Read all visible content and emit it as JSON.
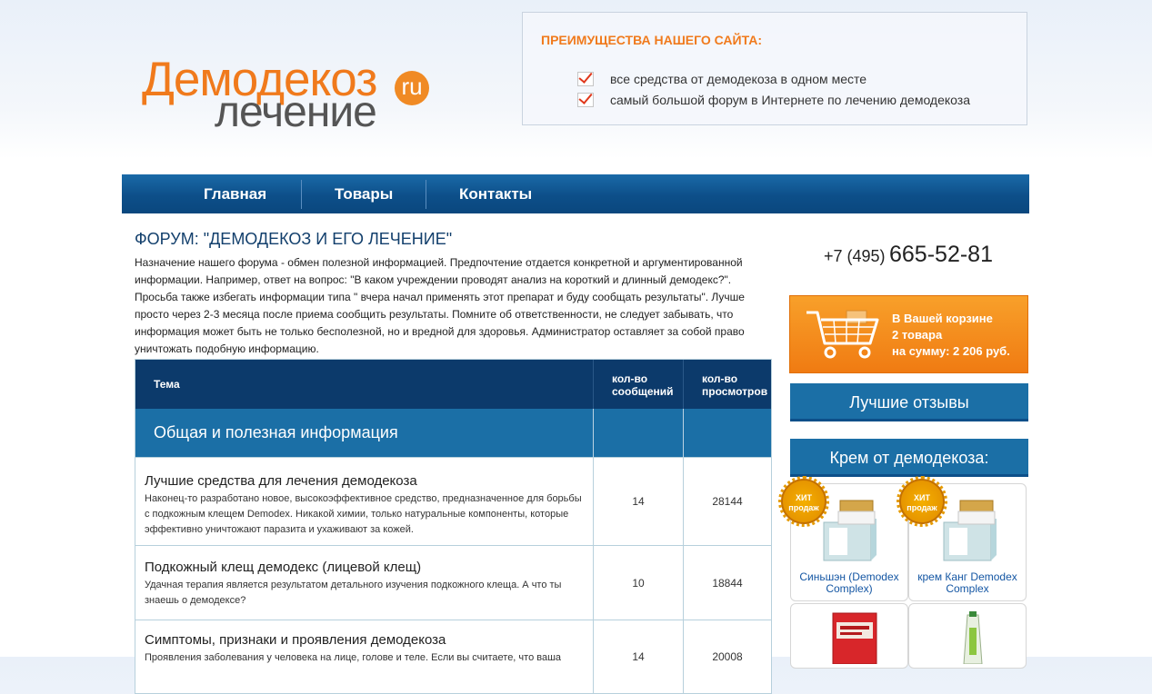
{
  "logo": {
    "line1": "Демодекоз",
    "badge": "ru",
    "line2": "лечение"
  },
  "advantages": {
    "title": "ПРЕИМУЩЕСТВА НАШЕГО САЙТА:",
    "items": [
      "все средства от демодекоза в одном месте",
      "самый большой форум в Интернете по лечению демодекоза"
    ]
  },
  "nav": {
    "items": [
      "Главная",
      "Товары",
      "Контакты"
    ]
  },
  "forum": {
    "title": "ФОРУМ: \"ДЕМОДЕКОЗ И ЕГО ЛЕЧЕНИЕ\"",
    "intro": "Назначение нашего форума - обмен полезной информацией. Предпочтение отдается конкретной и аргументированной информации. Например, ответ на вопрос: \"В каком учреждении проводят анализ на короткий и длинный демодекс?\". Просьба также избегать информации типа \" вчера начал применять этот препарат и буду сообщать результаты\". Лучше просто через 2-3 месяца после приема сообщить результаты. Помните об ответственности, не следует забывать, что информация может быть не только бесполезной, но и вредной для здоровья. Администратор оставляет за собой право уничтожать подобную информацию.",
    "columns": {
      "topic": "Тема",
      "messages_l1": "кол-во",
      "messages_l2": "сообщений",
      "views_l1": "кол-во",
      "views_l2": "просмотров"
    },
    "category": "Общая и полезная информация",
    "rows": [
      {
        "title": "Лучшие средства для лечения демодекоза",
        "desc": "Наконец-то разработано новое, высокоэффективное средство, предназначенное для борьбы с подкожным клещем Demodex. Никакой химии, только натуральные компоненты, которые эффективно уничтожают паразита и ухаживают за кожей.",
        "messages": "14",
        "views": "28144"
      },
      {
        "title": "Подкожный клещ демодекс (лицевой клещ)",
        "desc": "Удачная терапия является результатом детального изучения подкожного клеща. А что ты знаешь о демодексе?",
        "messages": "10",
        "views": "18844"
      },
      {
        "title": "Симптомы, признаки и проявления демодекоза",
        "desc": "Проявления заболевания у человека на лице, голове и теле. Если вы считаете, что ваша",
        "messages": "14",
        "views": "20008"
      }
    ]
  },
  "sidebar": {
    "phone_prefix": "+7 (495)",
    "phone_number": "665-52-81",
    "cart": {
      "line1": "В Вашей корзине",
      "line2": "2 товара",
      "line3": "на сумму: 2 206 руб."
    },
    "reviews_button": "Лучшие отзывы",
    "cream_heading": "Крем от демодекоза:",
    "badge_text_l1": "ХИТ",
    "badge_text_l2": "продаж",
    "products": [
      {
        "name_l1": "Синьшэн (Demodex",
        "name_l2": "Complex)"
      },
      {
        "name_l1": "крем Канг Demodex",
        "name_l2": "Complex"
      }
    ]
  },
  "colors": {
    "orange": "#f07a1c",
    "nav_blue": "#0d4f89",
    "header_blue": "#0c3a6b",
    "category_blue": "#1b6fa6",
    "link": "#1456a3"
  }
}
